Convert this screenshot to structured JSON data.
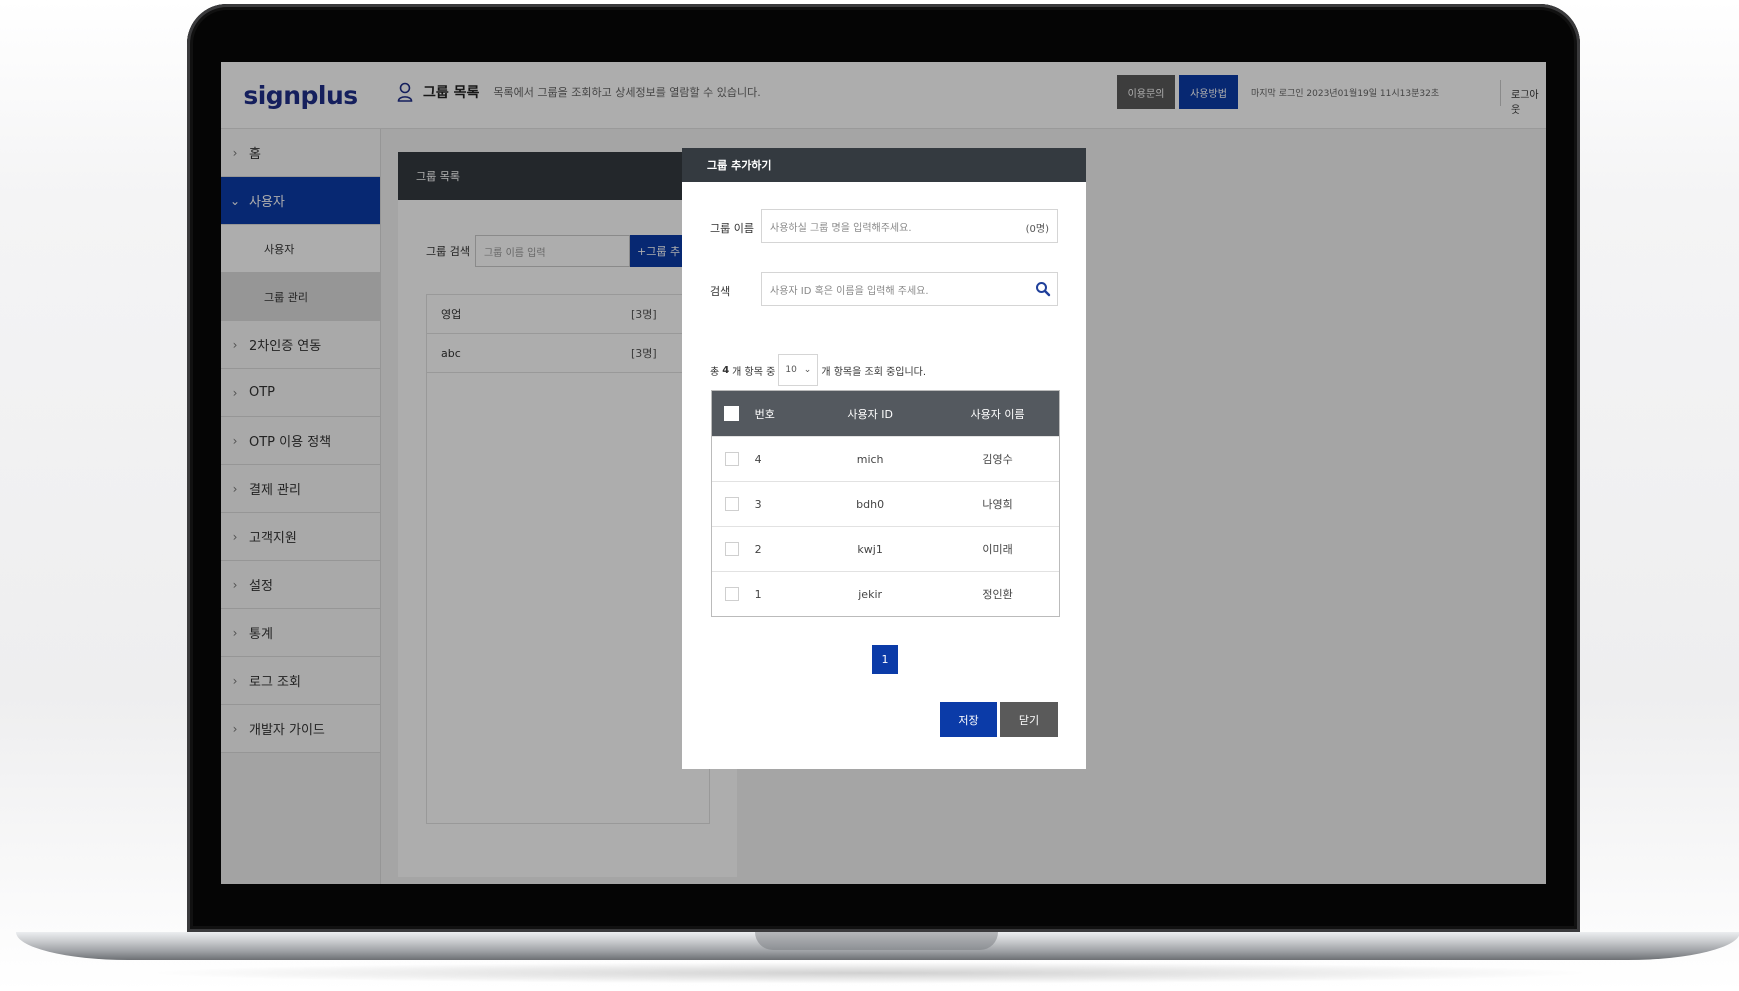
{
  "header": {
    "logo": "signplus",
    "page_title": "그룹 목록",
    "page_desc": "목록에서 그룹을 조회하고 상세정보를 열람할 수 있습니다.",
    "inquiry_label": "이용문의",
    "howto_label": "사용방법",
    "last_login": "마지막 로그인 2023년01월19일 11시13분32초",
    "logout_label": "로그아웃"
  },
  "sidebar": {
    "items": [
      {
        "label": "홈"
      },
      {
        "label": "사용자"
      },
      {
        "label": "2차인증 연동"
      },
      {
        "label": "OTP"
      },
      {
        "label": "OTP 이용 정책"
      },
      {
        "label": "결제 관리"
      },
      {
        "label": "고객지원"
      },
      {
        "label": "설정"
      },
      {
        "label": "통계"
      },
      {
        "label": "로그 조회"
      },
      {
        "label": "개발자 가이드"
      }
    ],
    "sub_items": [
      {
        "label": "사용자"
      },
      {
        "label": "그룹 관리"
      }
    ]
  },
  "group_panel": {
    "title": "그룹 목록",
    "search_label": "그룹 검색",
    "search_placeholder": "그룹 이름 입력",
    "add_button": "+그룹 추",
    "groups": [
      {
        "name": "영업",
        "count": "[3명]"
      },
      {
        "name": "abc",
        "count": "[3명]"
      }
    ]
  },
  "modal": {
    "title": "그룹 추가하기",
    "name_label": "그룹 이름",
    "name_placeholder": "사용하실 그룹 명을 입력해주세요.",
    "name_counter": "(0명)",
    "search_label": "검색",
    "search_placeholder": "사용자 ID 혹은 이름을 입력해 주세요.",
    "summary_prefix": "총",
    "summary_total": "4",
    "summary_mid": "개 항목 중",
    "page_size": "10",
    "summary_suffix": "개 항목을 조회 중입니다.",
    "columns": {
      "no": "번호",
      "user_id": "사용자 ID",
      "user_name": "사용자 이름"
    },
    "rows": [
      {
        "no": "4",
        "user_id": "mich",
        "user_name": "김영수"
      },
      {
        "no": "3",
        "user_id": "bdh0",
        "user_name": "나영희"
      },
      {
        "no": "2",
        "user_id": "kwj1",
        "user_name": "이미래"
      },
      {
        "no": "1",
        "user_id": "jekir",
        "user_name": "정인환"
      }
    ],
    "page": "1",
    "save_label": "저장",
    "close_label": "닫기"
  },
  "colors": {
    "primary": "#0b3ba8",
    "dark_header": "#343a40",
    "table_header": "#54595f",
    "gray_button": "#5a5a5a"
  }
}
